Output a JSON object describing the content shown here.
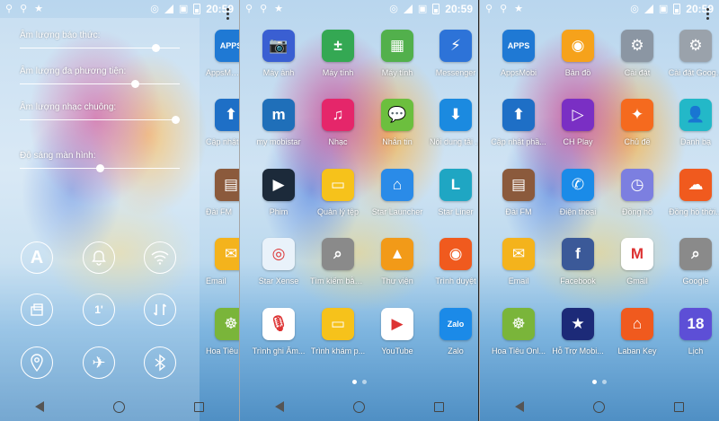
{
  "status": {
    "time": "20:59",
    "left_icons": [
      "usb-icon",
      "usb-icon",
      "star-notification-icon"
    ],
    "right_icons": [
      "hotspot-icon",
      "signal-icon",
      "no-sim-icon",
      "battery-icon"
    ]
  },
  "panel1": {
    "sliders": [
      {
        "label": "Âm lượng báo thức:",
        "value": 0.85
      },
      {
        "label": "Âm lượng đa phương tiện:",
        "value": 0.72
      },
      {
        "label": "Âm lượng nhạc chuông:",
        "value": 0.97
      },
      {
        "label": "Độ sáng màn hình:",
        "value": 0.5
      }
    ],
    "toggles": [
      {
        "name": "auto-brightness-toggle",
        "icon": "A",
        "filled": false
      },
      {
        "name": "sound-mode-toggle",
        "icon": "🔔",
        "filled": false
      },
      {
        "name": "wifi-toggle",
        "icon": "wifi",
        "filled": false
      },
      {
        "name": "screen-rotation-toggle",
        "icon": "rotate",
        "filled": false
      },
      {
        "name": "screen-timeout-toggle",
        "icon": "1'",
        "filled": false
      },
      {
        "name": "sync-toggle",
        "icon": "sync",
        "filled": false
      },
      {
        "name": "location-toggle",
        "icon": "location",
        "filled": false
      },
      {
        "name": "airplane-mode-toggle",
        "icon": "✈",
        "filled": false
      },
      {
        "name": "bluetooth-toggle",
        "icon": "bluetooth",
        "filled": false
      }
    ],
    "side_apps": [
      {
        "label": "AppsMobi",
        "color": "#1f79d4",
        "glyph": "APPS"
      },
      {
        "label": "Cập nhật",
        "color": "#1e6fc6",
        "glyph": "⬆"
      },
      {
        "label": "Đài FM",
        "color": "#8b5a3c",
        "glyph": "▤"
      },
      {
        "label": "Email",
        "color": "#f4b31c",
        "glyph": "✉"
      },
      {
        "label": "Hoa Tiêu",
        "color": "#7ab53a",
        "glyph": "☸"
      }
    ]
  },
  "panel2": {
    "apps": [
      {
        "label": "Máy ảnh",
        "color": "#3a5fd2",
        "glyph": "📷"
      },
      {
        "label": "Máy tính",
        "color": "#34a853",
        "glyph": "±"
      },
      {
        "label": "Máy tính",
        "color": "#52b04c",
        "glyph": "▦"
      },
      {
        "label": "Messenger",
        "color": "#2d73d8",
        "glyph": "⚡"
      },
      {
        "label": "my mobistar",
        "color": "#1f6fb9",
        "glyph": "m"
      },
      {
        "label": "Nhạc",
        "color": "#e5266a",
        "glyph": "♫"
      },
      {
        "label": "Nhắn tin",
        "color": "#6cbf3e",
        "glyph": "💬"
      },
      {
        "label": "Nội dung tải ...",
        "color": "#1b8ae0",
        "glyph": "⬇"
      },
      {
        "label": "Phim",
        "color": "#1c2a3a",
        "glyph": "▶"
      },
      {
        "label": "Quản lý tệp",
        "color": "#f6c21b",
        "glyph": "▭"
      },
      {
        "label": "Star Launcher",
        "color": "#2a8be8",
        "glyph": "⌂"
      },
      {
        "label": "Star Liner",
        "color": "#1fa6c3",
        "glyph": "L"
      },
      {
        "label": "Star Xense",
        "color": "#e9f2fa",
        "glyph": "◎"
      },
      {
        "label": "Tìm kiếm bằng...",
        "color": "#8a8a8a",
        "glyph": "⌕"
      },
      {
        "label": "Thư viện",
        "color": "#f29a18",
        "glyph": "▲"
      },
      {
        "label": "Trình duyệt",
        "color": "#f05a1e",
        "glyph": "◉"
      },
      {
        "label": "Trình ghi Âm...",
        "color": "#ffffff",
        "glyph": "🎙"
      },
      {
        "label": "Trình khám p...",
        "color": "#f6c21b",
        "glyph": "▭"
      },
      {
        "label": "YouTube",
        "color": "#ffffff",
        "glyph": "▶"
      },
      {
        "label": "Zalo",
        "color": "#1b8ae8",
        "glyph": "Zalo"
      }
    ]
  },
  "panel3": {
    "apps": [
      {
        "label": "AppsMobi",
        "color": "#1f79d4",
        "glyph": "APPS"
      },
      {
        "label": "Bản đồ",
        "color": "#f6a21b",
        "glyph": "◉"
      },
      {
        "label": "Cài đặt",
        "color": "#8b96a3",
        "glyph": "⚙"
      },
      {
        "label": "Cài đặt Goog...",
        "color": "#9aa2ab",
        "glyph": "⚙"
      },
      {
        "label": "Cập nhật phầ...",
        "color": "#1e6fc6",
        "glyph": "⬆"
      },
      {
        "label": "CH Play",
        "color": "#7a2fc4",
        "glyph": "▷"
      },
      {
        "label": "Chủ đề",
        "color": "#f56a1e",
        "glyph": "✦"
      },
      {
        "label": "Danh bạ",
        "color": "#23b8c8",
        "glyph": "👤"
      },
      {
        "label": "Đài FM",
        "color": "#8b5a3c",
        "glyph": "▤"
      },
      {
        "label": "Điện thoại",
        "color": "#1a8be8",
        "glyph": "✆"
      },
      {
        "label": "Đồng hồ",
        "color": "#7c7fe0",
        "glyph": "◷"
      },
      {
        "label": "Đồng hồ thời...",
        "color": "#f05a1e",
        "glyph": "☁"
      },
      {
        "label": "Email",
        "color": "#f4b31c",
        "glyph": "✉"
      },
      {
        "label": "Facebook",
        "color": "#3b5998",
        "glyph": "f"
      },
      {
        "label": "Gmail",
        "color": "#ffffff",
        "glyph": "M"
      },
      {
        "label": "Google",
        "color": "#8a8a8a",
        "glyph": "⌕"
      },
      {
        "label": "Hoa Tiêu Onl...",
        "color": "#7ab53a",
        "glyph": "☸"
      },
      {
        "label": "Hỗ Trợ Mobi...",
        "color": "#1c2a78",
        "glyph": "★"
      },
      {
        "label": "Laban Key",
        "color": "#f05a1e",
        "glyph": "⌂"
      },
      {
        "label": "Lịch",
        "color": "#5d4fd6",
        "glyph": "18"
      }
    ]
  },
  "nav": {
    "more_label": "⋮"
  }
}
